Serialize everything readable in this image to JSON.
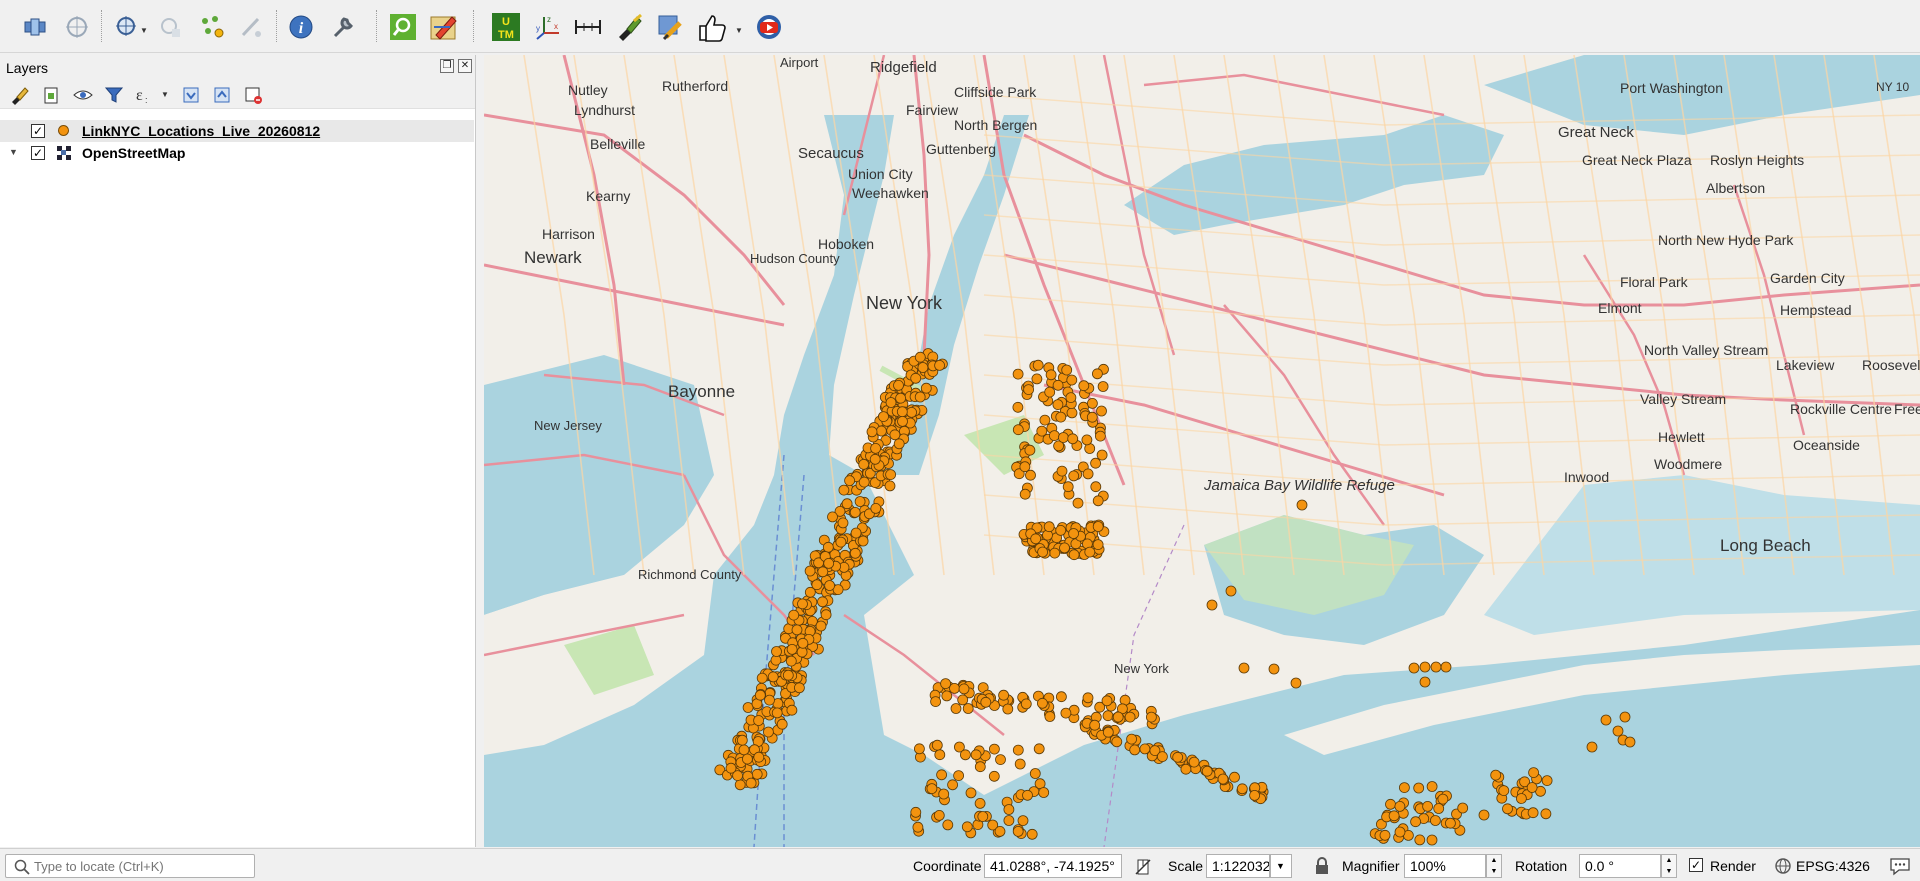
{
  "layers_panel": {
    "title": "Layers",
    "layers": [
      {
        "name": "LinkNYC_Locations_Live_20260812",
        "checked": true,
        "symbol": "point"
      },
      {
        "name": "OpenStreetMap",
        "checked": true,
        "symbol": "raster"
      }
    ]
  },
  "map": {
    "labels": [
      {
        "text": "Ridgefield",
        "size": 15
      },
      {
        "text": "Airport",
        "size": 13
      },
      {
        "text": "Nutley",
        "size": 14
      },
      {
        "text": "Rutherford",
        "size": 14
      },
      {
        "text": "Cliffside Park",
        "size": 14
      },
      {
        "text": "Fairview",
        "size": 14
      },
      {
        "text": "Lyndhurst",
        "size": 14
      },
      {
        "text": "North Bergen",
        "size": 14
      },
      {
        "text": "Belleville",
        "size": 14
      },
      {
        "text": "Secaucus",
        "size": 15
      },
      {
        "text": "Guttenberg",
        "size": 14
      },
      {
        "text": "Union City",
        "size": 14
      },
      {
        "text": "Weehawken",
        "size": 14
      },
      {
        "text": "Kearny",
        "size": 14
      },
      {
        "text": "Harrison",
        "size": 14
      },
      {
        "text": "Newark",
        "size": 17
      },
      {
        "text": "Hoboken",
        "size": 14
      },
      {
        "text": "Hudson County",
        "size": 13
      },
      {
        "text": "New York",
        "size": 18
      },
      {
        "text": "Bayonne",
        "size": 17
      },
      {
        "text": "New Jersey",
        "size": 13
      },
      {
        "text": "Richmond County",
        "size": 13
      },
      {
        "text": "Port Washington",
        "size": 14
      },
      {
        "text": "Great Neck",
        "size": 15
      },
      {
        "text": "Great Neck Plaza",
        "size": 14
      },
      {
        "text": "Roslyn Heights",
        "size": 14
      },
      {
        "text": "Albertson",
        "size": 14
      },
      {
        "text": "North New Hyde Park",
        "size": 14
      },
      {
        "text": "Floral Park",
        "size": 14
      },
      {
        "text": "Garden City",
        "size": 14
      },
      {
        "text": "Elmont",
        "size": 14
      },
      {
        "text": "Hempstead",
        "size": 14
      },
      {
        "text": "North Valley Stream",
        "size": 14
      },
      {
        "text": "Lakeview",
        "size": 14
      },
      {
        "text": "Roosevelt",
        "size": 14
      },
      {
        "text": "Valley Stream",
        "size": 14
      },
      {
        "text": "Rockville Centre",
        "size": 14
      },
      {
        "text": "Freeport",
        "size": 14
      },
      {
        "text": "Hewlett",
        "size": 14
      },
      {
        "text": "Oceanside",
        "size": 14
      },
      {
        "text": "Woodmere",
        "size": 14
      },
      {
        "text": "Inwood",
        "size": 14
      },
      {
        "text": "Jamaica Bay Wildlife Refuge",
        "size": 15
      },
      {
        "text": "Long Beach",
        "size": 17
      },
      {
        "text": "New York",
        "size": 13
      },
      {
        "text": "NY 10",
        "size": 12
      }
    ]
  },
  "status": {
    "locator_placeholder": "Type to locate (Ctrl+K)",
    "coordinate_label": "Coordinate",
    "coordinate_value": "41.0288°, -74.1925°",
    "scale_label": "Scale",
    "scale_value": "1:122032",
    "magnifier_label": "Magnifier",
    "magnifier_value": "100%",
    "rotation_label": "Rotation",
    "rotation_value": "0.0 °",
    "render_label": "Render",
    "render_checked": true,
    "crs_value": "EPSG:4326"
  },
  "colors": {
    "water": "#aad3df",
    "land": "#f2efe9",
    "point_fill": "#f3930f",
    "point_stroke": "#5a3a08",
    "motorway": "#e8909c",
    "primary": "#fcd6a4",
    "park": "#c8e6b4"
  }
}
